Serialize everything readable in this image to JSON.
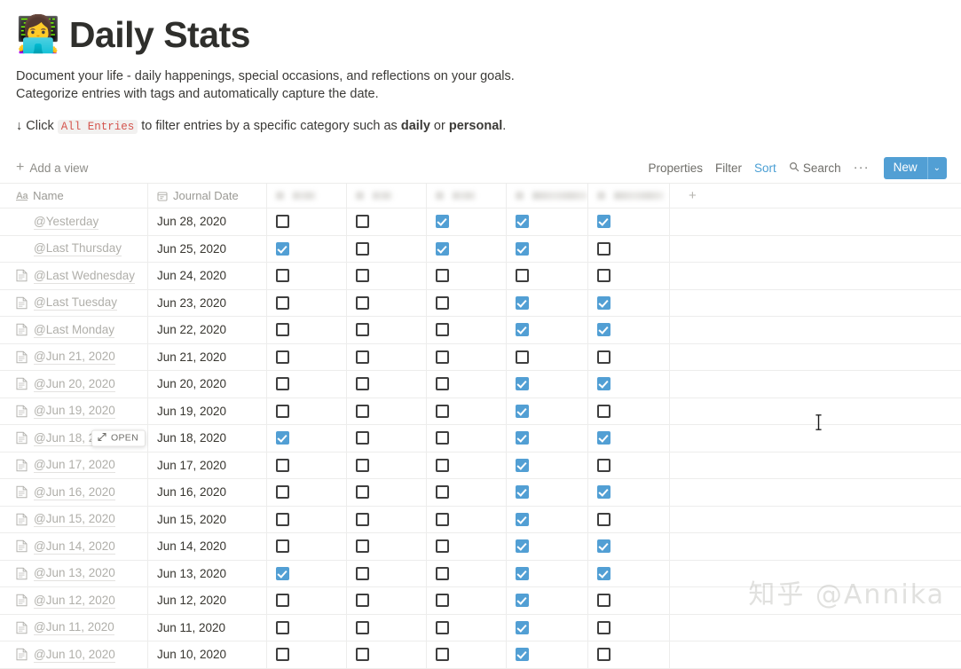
{
  "page": {
    "emoji": "👩‍💻",
    "title": "Daily Stats",
    "description_line1": "Document your life - daily happenings, special occasions, and reflections on your goals.",
    "description_line2": "Categorize entries with tags and automatically capture the date.",
    "hint_prefix": "↓ Click",
    "hint_code": "All Entries",
    "hint_middle": "to filter entries by a specific category such as",
    "hint_bold1": "daily",
    "hint_or": "or",
    "hint_bold2": "personal",
    "hint_suffix": "."
  },
  "toolbar": {
    "add_view_label": "Add a view",
    "add_view_icon": "plus-icon",
    "properties_label": "Properties",
    "filter_label": "Filter",
    "sort_label": "Sort",
    "search_label": "Search",
    "search_icon": "search-icon",
    "more_label": "···",
    "new_label": "New",
    "new_caret": "⌄",
    "accent_color": "#529fd4",
    "active_link_color": "#4a9fd4"
  },
  "table": {
    "columns": [
      {
        "key": "name",
        "label": "Name",
        "icon": "text-aa-icon",
        "blurred": false
      },
      {
        "key": "date",
        "label": "Journal Date",
        "icon": "calendar-icon",
        "blurred": false
      },
      {
        "key": "cb1",
        "label": "",
        "icon": "checkbox-icon",
        "blurred": true
      },
      {
        "key": "cb2",
        "label": "",
        "icon": "checkbox-icon",
        "blurred": true
      },
      {
        "key": "cb3",
        "label": "",
        "icon": "checkbox-icon",
        "blurred": true
      },
      {
        "key": "cb4",
        "label": "",
        "icon": "checkbox-icon",
        "blurred": true
      },
      {
        "key": "cb5",
        "label": "",
        "icon": "checkbox-icon",
        "blurred": true
      }
    ],
    "add_column_label": "+",
    "hover_row_index": 10,
    "hover_open_label": "OPEN",
    "hover_open_icon": "expand-arrow-icon",
    "rows": [
      {
        "name": "@Yesterday",
        "date": "Jun 28, 2020",
        "has_page_icon": false,
        "checks": [
          false,
          false,
          true,
          true,
          true
        ]
      },
      {
        "name": "@Last Thursday",
        "date": "Jun 25, 2020",
        "has_page_icon": false,
        "checks": [
          true,
          false,
          true,
          true,
          false
        ]
      },
      {
        "name": "@Last Wednesday",
        "date": "Jun 24, 2020",
        "has_page_icon": true,
        "checks": [
          false,
          false,
          false,
          false,
          false
        ]
      },
      {
        "name": "@Last Tuesday",
        "date": "Jun 23, 2020",
        "has_page_icon": true,
        "checks": [
          false,
          false,
          false,
          true,
          true
        ]
      },
      {
        "name": "@Last Monday",
        "date": "Jun 22, 2020",
        "has_page_icon": true,
        "checks": [
          false,
          false,
          false,
          true,
          true
        ]
      },
      {
        "name": "@Jun 21, 2020",
        "date": "Jun 21, 2020",
        "has_page_icon": true,
        "checks": [
          false,
          false,
          false,
          false,
          false
        ]
      },
      {
        "name": "@Jun 20, 2020",
        "date": "Jun 20, 2020",
        "has_page_icon": true,
        "checks": [
          false,
          false,
          false,
          true,
          true
        ]
      },
      {
        "name": "@Jun 19, 2020",
        "date": "Jun 19, 2020",
        "has_page_icon": true,
        "checks": [
          false,
          false,
          false,
          true,
          false
        ]
      },
      {
        "name": "@Jun 18, 2020",
        "date": "Jun 18, 2020",
        "has_page_icon": true,
        "checks": [
          true,
          false,
          false,
          true,
          true
        ]
      },
      {
        "name": "@Jun 17, 2020",
        "date": "Jun 17, 2020",
        "has_page_icon": true,
        "checks": [
          false,
          false,
          false,
          true,
          false
        ]
      },
      {
        "name": "@Jun 16, 2020",
        "date": "Jun 16, 2020",
        "has_page_icon": true,
        "checks": [
          false,
          false,
          false,
          true,
          true
        ]
      },
      {
        "name": "@Jun 15, 2020",
        "date": "Jun 15, 2020",
        "has_page_icon": true,
        "checks": [
          false,
          false,
          false,
          true,
          false
        ]
      },
      {
        "name": "@Jun 14, 2020",
        "date": "Jun 14, 2020",
        "has_page_icon": true,
        "checks": [
          false,
          false,
          false,
          true,
          true
        ]
      },
      {
        "name": "@Jun 13, 2020",
        "date": "Jun 13, 2020",
        "has_page_icon": true,
        "checks": [
          true,
          false,
          false,
          true,
          true
        ]
      },
      {
        "name": "@Jun 12, 2020",
        "date": "Jun 12, 2020",
        "has_page_icon": true,
        "checks": [
          false,
          false,
          false,
          true,
          false
        ]
      },
      {
        "name": "@Jun 11, 2020",
        "date": "Jun 11, 2020",
        "has_page_icon": true,
        "checks": [
          false,
          false,
          false,
          true,
          false
        ]
      },
      {
        "name": "@Jun 10, 2020",
        "date": "Jun 10, 2020",
        "has_page_icon": true,
        "checks": [
          false,
          false,
          false,
          true,
          false
        ]
      }
    ]
  },
  "watermark": {
    "text": "知乎 @Annika"
  }
}
